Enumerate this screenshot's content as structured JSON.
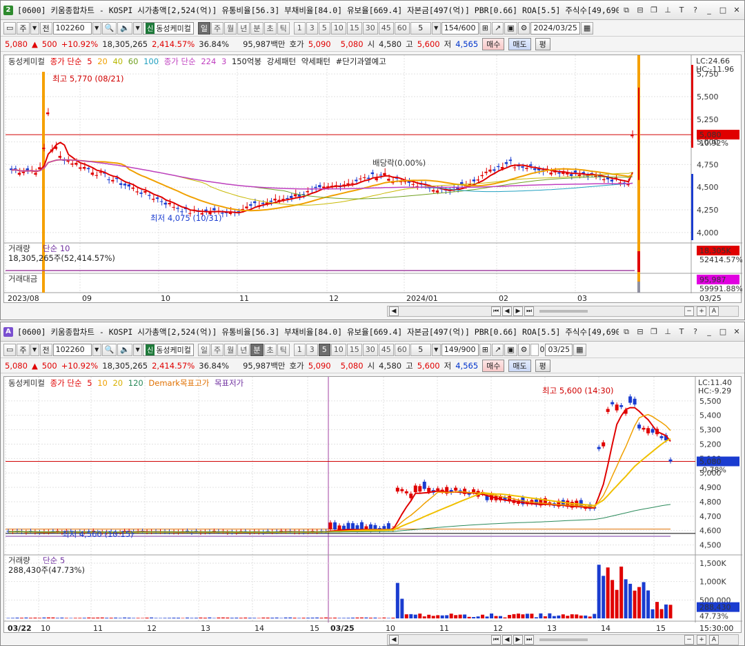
{
  "top": {
    "badge": "2",
    "badge_color": "#2e8b2e",
    "title": "[0600] 키움종합차트 - KOSPI 시가총액[2,524(억)] 유통비율[56.3] 부채비율[84.0] 유보율[669.4] 자본금[497(억)] PBR[0.66] ROA[5.5] 주식수[49,690(천)]",
    "toolbar": {
      "type1": "주",
      "type2": "전",
      "code": "102260",
      "new_badge": "신",
      "stock_name": "동성케미컬",
      "periods": [
        "일",
        "주",
        "월",
        "년",
        "분",
        "초",
        "틱"
      ],
      "selected_period": "일",
      "numbers": [
        "1",
        "3",
        "5",
        "10",
        "15",
        "30",
        "45",
        "60"
      ],
      "combo": "5",
      "count": "154/600",
      "date": "2024/03/25"
    },
    "quote": {
      "price": "5,080",
      "change": "500",
      "rate": "+10.92%",
      "volume": "18,305,265",
      "vol_rate": "2,414.57%",
      "turnover": "36.84%",
      "amount": "95,987백만",
      "hoga_label": "호가",
      "ask": "5,090",
      "bid": "5,080",
      "open_label": "시",
      "open": "4,580",
      "high_label": "고",
      "high": "5,600",
      "low_label": "저",
      "low": "4,565",
      "buy": "매수",
      "sell": "매도",
      "avg": "평"
    },
    "legend": {
      "name": "동성케미컬",
      "ma_label": "종가 단순",
      "ma": [
        "5",
        "20",
        "40",
        "60",
        "100"
      ],
      "ma2_label": "종가 단순",
      "ma2": [
        "224",
        "3"
      ],
      "ind1": "150억봉",
      "ind2": "강세패턴",
      "ind3": "약세패턴",
      "ind4": "#단기과열예고"
    },
    "annotations": {
      "high": "최고 5,770 (08/21)",
      "low": "최저 4,075 (10/31)",
      "dividend": "배당락(0.00%)"
    },
    "right_labels": {
      "lc": "LC:24.66",
      "hc": "HC:-11.96",
      "price": "5,080",
      "pct": "10.92%"
    },
    "y_ticks": [
      "5,750",
      "5,500",
      "5,250",
      "5,000",
      "4,750",
      "4,500",
      "4,250",
      "4,000"
    ],
    "volume_pane": {
      "label": "거래량",
      "ma": "단순 10",
      "info": "18,305,265주(52,414.57%)",
      "right_val": "18,305K",
      "right_pct": "52414.57%"
    },
    "amount_pane": {
      "label": "거래대금",
      "right_val": "95,987",
      "right_pct": "59991.88%"
    },
    "x_labels": [
      "2023/08",
      "09",
      "10",
      "11",
      "12",
      "2024/01",
      "02",
      "03"
    ],
    "x_end": "03/25"
  },
  "bottom": {
    "badge": "A",
    "badge_color": "#7a4fd0",
    "title": "[0600] 키움종합차트 - KOSPI 시가총액[2,524(억)] 유통비율[56.3] 부채비율[84.0] 유보율[669.4] 자본금[497(억)] PBR[0.66] ROA[5.5] 주식수[49,690(천)]",
    "toolbar": {
      "type1": "주",
      "type2": "전",
      "code": "102260",
      "new_badge": "신",
      "stock_name": "동성케미컬",
      "periods": [
        "일",
        "주",
        "월",
        "년",
        "분",
        "초",
        "틱"
      ],
      "selected_period": "분",
      "numbers": [
        "1",
        "3",
        "5",
        "10",
        "15",
        "30",
        "45",
        "60"
      ],
      "selected_number": "5",
      "combo": "5",
      "count": "149/900",
      "check_label": "0",
      "date": "03/25"
    },
    "quote": {
      "price": "5,080",
      "change": "500",
      "rate": "+10.92%",
      "volume": "18,305,265",
      "vol_rate": "2,414.57%",
      "turnover": "36.84%",
      "amount": "95,987백만",
      "hoga_label": "호가",
      "ask": "5,090",
      "bid": "5,080",
      "open_label": "시",
      "open": "4,580",
      "high_label": "고",
      "high": "5,600",
      "low_label": "저",
      "low": "4,565",
      "buy": "매수",
      "sell": "매도",
      "avg": "평"
    },
    "legend": {
      "name": "동성케미컬",
      "ma_label": "종가 단순",
      "ma": [
        "5",
        "10",
        "20",
        "120"
      ],
      "ind1": "Demark목표고가",
      "ind2": "목표저가"
    },
    "annotations": {
      "high": "최고 5,600 (14:30)",
      "low": "최저 4,560 (10:15)"
    },
    "right_labels": {
      "lc": "LC:11.40",
      "hc": "HC:-9.29",
      "price": "5,080",
      "pct": "-0.78%"
    },
    "y_ticks": [
      "5,500",
      "5,400",
      "5,300",
      "5,200",
      "5,100",
      "5,000",
      "4,900",
      "4,800",
      "4,700",
      "4,600",
      "4,500"
    ],
    "volume_pane": {
      "label": "거래량",
      "ma": "단순 5",
      "info": "288,430주(47.73%)",
      "right_val": "288,430",
      "right_pct": "47.73%",
      "ticks": [
        "1,500K",
        "1,000K",
        "500,000"
      ]
    },
    "x_labels": [
      "03/22",
      "10",
      "11",
      "12",
      "13",
      "14",
      "15",
      "03/25",
      "10",
      "11",
      "12",
      "13",
      "14",
      "15"
    ],
    "x_end": "15:30:00"
  }
}
